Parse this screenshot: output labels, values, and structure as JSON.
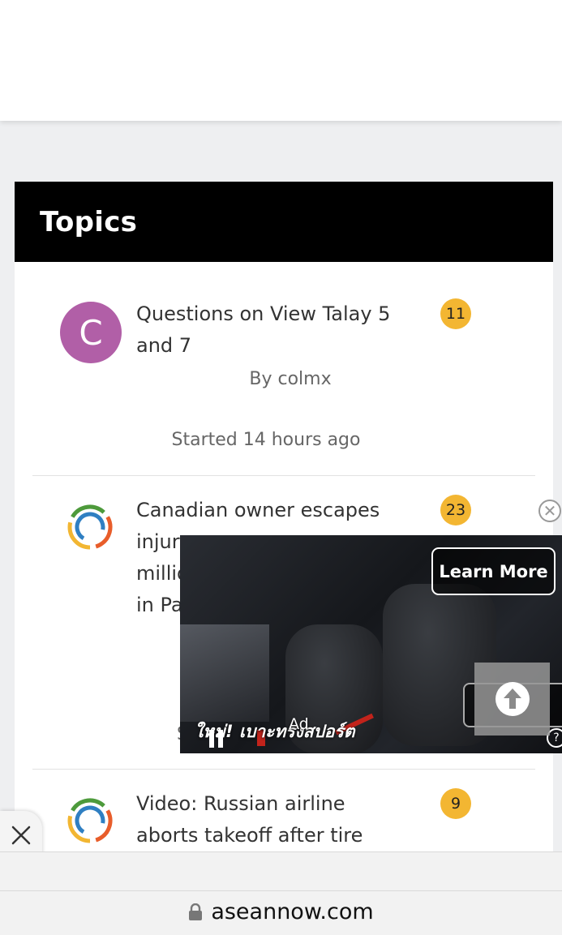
{
  "section": {
    "title": "Topics"
  },
  "topics": [
    {
      "avatar_letter": "C",
      "title": "Questions on View Talay 5 and 7",
      "byline": "By colmx",
      "started": "Started 14 hours ago",
      "reply_count": "11"
    },
    {
      "title": "Canadian owner escapes injur",
      "title_lines": [
        "Canadian owner escapes",
        "injur",
        "millio",
        "in Pa"
      ],
      "byline_fragment": "S",
      "reply_count": "23"
    },
    {
      "title_lines": [
        "Video: Russian airline",
        "aborts takeoff after tire"
      ],
      "reply_count": "9"
    }
  ],
  "ad": {
    "learn_more_label": "Learn More",
    "caption": "ใหม่! เบาะทรงสปอร์ต",
    "ad_label": "Ad",
    "help_label": "?",
    "skip_fragment": "I",
    "close_label": "✕"
  },
  "browser": {
    "url": "aseannow.com"
  },
  "colors": {
    "accent_badge": "#f3b632",
    "avatar_purple": "#b15fa7",
    "header_black": "#000000"
  }
}
